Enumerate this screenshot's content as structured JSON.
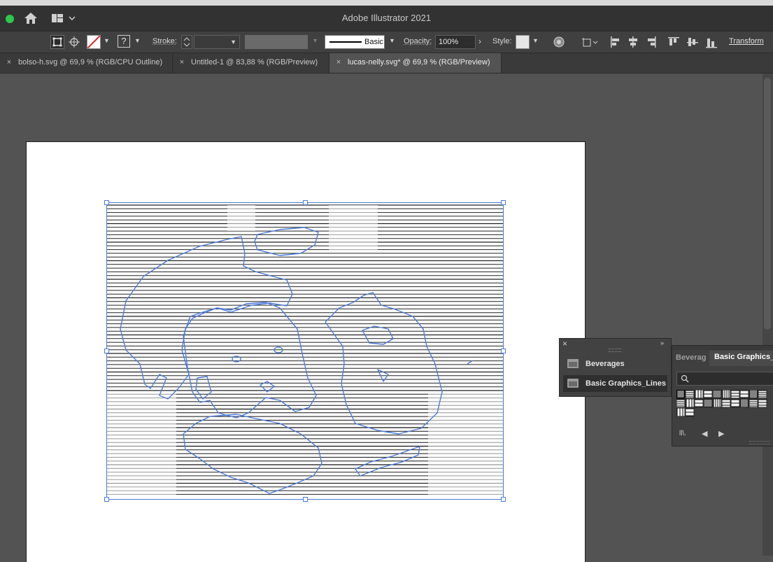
{
  "app": {
    "title": "Adobe Illustrator 2021"
  },
  "control_bar": {
    "stroke_label": "Stroke:",
    "brush_label": "Basic",
    "opacity_label": "Opacity:",
    "opacity_value": "100%",
    "style_label": "Style:",
    "transform_label": "Transform",
    "fill_icon_text": "?"
  },
  "tabs": [
    {
      "label": "bolso-h.svg @ 69,9 % (RGB/CPU Outline)",
      "active": false
    },
    {
      "label": "Untitled-1 @ 83,88 % (RGB/Preview)",
      "active": false
    },
    {
      "label": "lucas-nelly.svg* @ 69,9 % (RGB/Preview)",
      "active": true
    }
  ],
  "libraries_panel": {
    "items": [
      {
        "label": "Beverages",
        "selected": false
      },
      {
        "label": "Basic Graphics_Lines",
        "selected": true
      }
    ]
  },
  "swatches_panel": {
    "tabs": [
      {
        "label": "Beverag",
        "active": false
      },
      {
        "label": "Basic Graphics_Li",
        "active": true
      }
    ],
    "search_placeholder": ""
  },
  "colors": {
    "selection": "#4a7bd9",
    "ui_dark": "#323232",
    "ui_mid": "#404040",
    "canvas": "#535353",
    "traffic_green": "#2ec84b"
  }
}
